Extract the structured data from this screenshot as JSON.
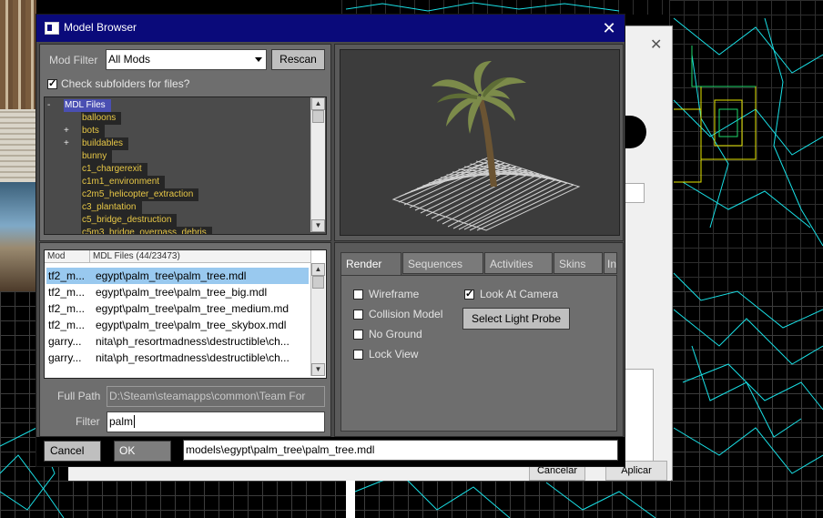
{
  "dialog": {
    "title": "Model Browser",
    "close_glyph": "✕"
  },
  "filter_panel": {
    "mod_filter_label": "Mod Filter",
    "mod_filter_value": "All Mods",
    "rescan_label": "Rescan",
    "subfolders_label": "Check subfolders for files?",
    "subfolders_checked": true
  },
  "tree": {
    "root": {
      "expander": "-",
      "label": "MDL Files"
    },
    "items": [
      {
        "expander": "",
        "label": "balloons"
      },
      {
        "expander": "+",
        "label": "bots"
      },
      {
        "expander": "+",
        "label": "buildables"
      },
      {
        "expander": "",
        "label": "bunny"
      },
      {
        "expander": "",
        "label": "c1_chargerexit"
      },
      {
        "expander": "",
        "label": "c1m1_environment"
      },
      {
        "expander": "",
        "label": "c2m5_helicopter_extraction"
      },
      {
        "expander": "",
        "label": "c3_plantation"
      },
      {
        "expander": "",
        "label": "c5_bridge_destruction"
      },
      {
        "expander": "",
        "label": "c5m3_bridge_overpass_debris"
      }
    ]
  },
  "file_list": {
    "col_mod": "Mod",
    "col_files": "MDL Files (44/23473)",
    "rows": [
      {
        "mod": "tf2_m...",
        "path": "egypt\\palm_tree\\palm_tree.mdl",
        "selected": true
      },
      {
        "mod": "tf2_m...",
        "path": "egypt\\palm_tree\\palm_tree_big.mdl",
        "selected": false
      },
      {
        "mod": "tf2_m...",
        "path": "egypt\\palm_tree\\palm_tree_medium.md",
        "selected": false
      },
      {
        "mod": "tf2_m...",
        "path": "egypt\\palm_tree\\palm_tree_skybox.mdl",
        "selected": false
      },
      {
        "mod": "garry...",
        "path": "nita\\ph_resortmadness\\destructible\\ch...",
        "selected": false
      },
      {
        "mod": "garry...",
        "path": "nita\\ph_resortmadness\\destructible\\ch...",
        "selected": false
      }
    ]
  },
  "paths": {
    "full_path_label": "Full Path",
    "full_path_value": "D:\\Steam\\steamapps\\common\\Team For",
    "filter_label": "Filter",
    "filter_value": "palm"
  },
  "tabs": [
    "Render",
    "Sequences",
    "Activities",
    "Skins",
    "In"
  ],
  "render_options": {
    "wireframe": {
      "label": "Wireframe",
      "checked": false
    },
    "collision": {
      "label": "Collision Model",
      "checked": false
    },
    "no_ground": {
      "label": "No Ground",
      "checked": false
    },
    "lock_view": {
      "label": "Lock View",
      "checked": false
    },
    "look_at_camera": {
      "label": "Look At Camera",
      "checked": true
    },
    "light_probe_button": "Select Light Probe"
  },
  "footer": {
    "cancel_label": "Cancel",
    "ok_label": "OK",
    "model_path": "models\\egypt\\palm_tree\\palm_tree.mdl"
  },
  "background": {
    "cancelar_label": "Cancelar",
    "aplicar_label": "Aplicar",
    "close_glyph": "✕"
  }
}
